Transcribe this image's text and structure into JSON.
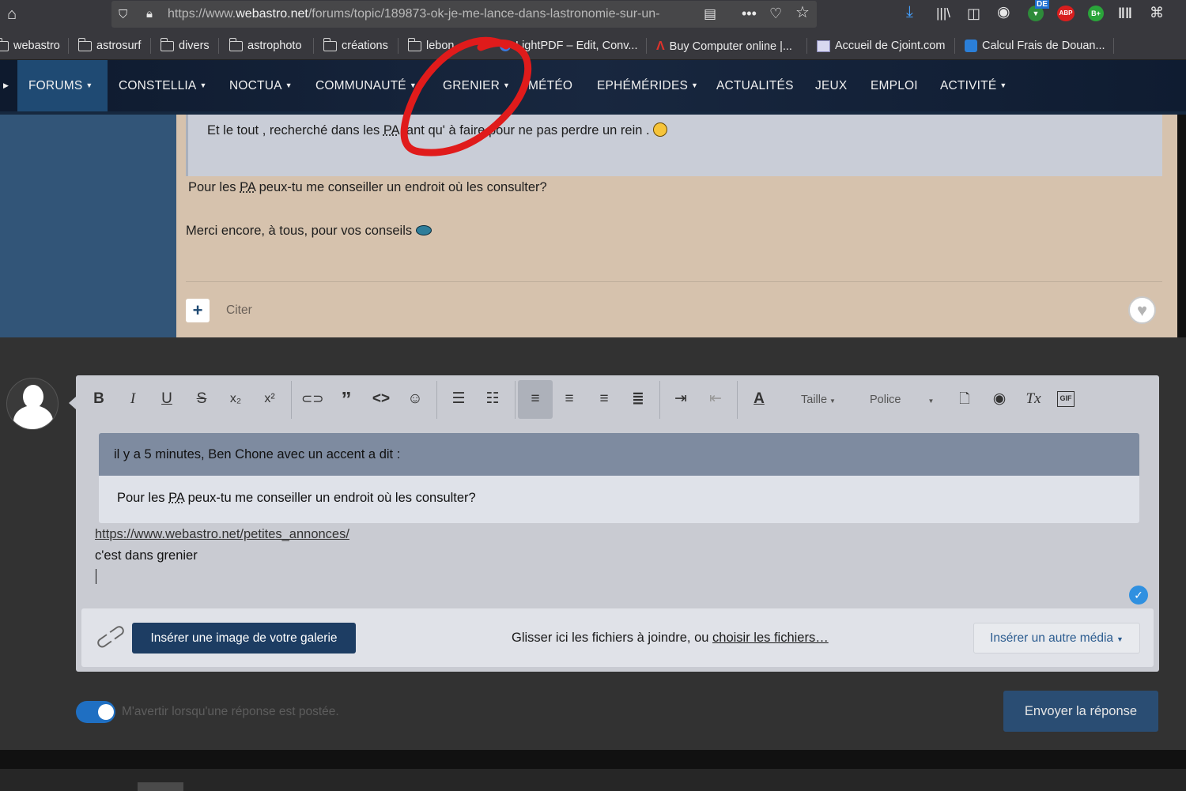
{
  "browser": {
    "url_prefix": "https://www.",
    "url_domain": "webastro.net",
    "url_path": "/forums/topic/189873-ok-je-me-lance-dans-lastronomie-sur-un-",
    "extension_de": "DE",
    "extension_abp": "ABP",
    "extension_bplus": "B+"
  },
  "bookmarks": [
    {
      "label": "webastro"
    },
    {
      "label": "astrosurf"
    },
    {
      "label": "divers"
    },
    {
      "label": "astrophoto"
    },
    {
      "label": "créations"
    },
    {
      "label": "lebon..."
    },
    {
      "label": "LightPDF – Edit, Conv..."
    },
    {
      "label": "Buy Computer online |..."
    },
    {
      "label": "Accueil de Cjoint.com"
    },
    {
      "label": "Calcul Frais de Douan..."
    }
  ],
  "site_nav": [
    {
      "label": "FORUMS",
      "dropdown": true
    },
    {
      "label": "CONSTELLIA",
      "dropdown": true
    },
    {
      "label": "NOCTUA",
      "dropdown": true
    },
    {
      "label": "COMMUNAUTÉ",
      "dropdown": true
    },
    {
      "label": "GRENIER",
      "dropdown": true
    },
    {
      "label": "MÉTÉO",
      "dropdown": false
    },
    {
      "label": "EPHÉMÉRIDES",
      "dropdown": true
    },
    {
      "label": "ACTUALITÉS",
      "dropdown": false
    },
    {
      "label": "JEUX",
      "dropdown": false
    },
    {
      "label": "EMPLOI",
      "dropdown": false
    },
    {
      "label": "ACTIVITÉ",
      "dropdown": true
    }
  ],
  "post": {
    "quote_line_a": "Et le tout , recherché dans les ",
    "quote_abbr": "PA",
    "quote_line_b": " tant qu' à faire pour ne pas perdre un rein .",
    "line1_a": "Pour les ",
    "line1_abbr": "PA",
    "line1_b": " peux-tu me conseiller un endroit où les consulter?",
    "line2": "Merci encore, à tous, pour vos conseils",
    "citer_label": "Citer"
  },
  "editor": {
    "toolbar": {
      "size_label": "Taille",
      "font_label": "Police"
    },
    "quote_header": "il y a 5 minutes, Ben Chone avec un accent a dit :",
    "quote_body_a": "Pour les ",
    "quote_body_abbr": "PA",
    "quote_body_b": " peux-tu me conseiller un endroit où les consulter?",
    "link_text": "https://www.webastro.net/petites_annonces/",
    "line2": "c'est dans grenier"
  },
  "attachments": {
    "gallery_button": "Insérer une image de votre galerie",
    "drop_text": "Glisser ici les fichiers à joindre, ou ",
    "drop_link": "choisir les fichiers…",
    "media_button": "Insérer un autre média"
  },
  "notify": {
    "label": "M'avertir lorsqu'une réponse est postée.",
    "enabled": true
  },
  "submit_label": "Envoyer la réponse",
  "colors": {
    "nav_active": "#1f4a73",
    "post_bg": "#d6c2ad",
    "quote_header": "#7e8ba0",
    "submit": "#2a4d73",
    "annotation": "#e01b1b"
  }
}
